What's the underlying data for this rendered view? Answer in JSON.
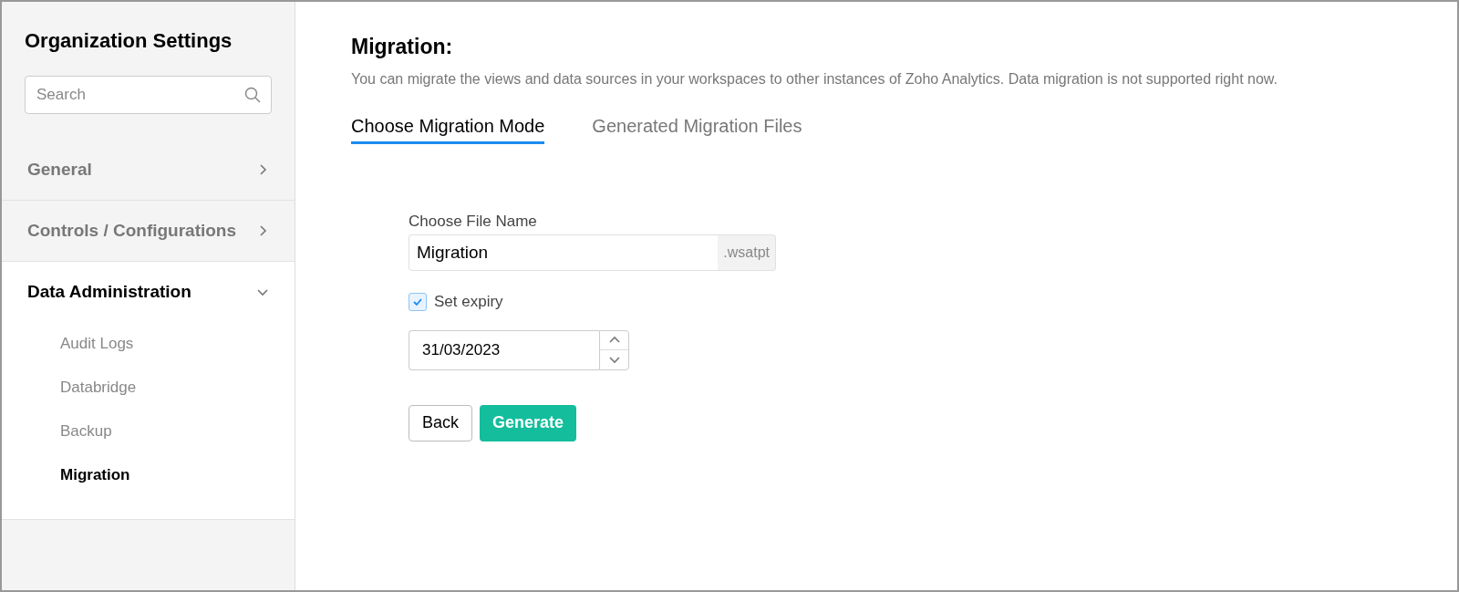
{
  "sidebar": {
    "title": "Organization Settings",
    "search": {
      "placeholder": "Search"
    },
    "sections": [
      {
        "label": "General",
        "expanded": false
      },
      {
        "label": "Controls / Configurations",
        "expanded": false
      },
      {
        "label": "Data Administration",
        "expanded": true,
        "children": [
          {
            "label": "Audit Logs",
            "selected": false
          },
          {
            "label": "Databridge",
            "selected": false
          },
          {
            "label": "Backup",
            "selected": false
          },
          {
            "label": "Migration",
            "selected": true
          }
        ]
      }
    ]
  },
  "main": {
    "title": "Migration:",
    "description": "You can migrate the views and data sources in your workspaces to other instances of Zoho Analytics. Data migration is not supported right now.",
    "tabs": [
      {
        "label": "Choose Migration Mode",
        "selected": true
      },
      {
        "label": "Generated Migration Files",
        "selected": false
      }
    ],
    "form": {
      "file_label": "Choose File Name",
      "file_value": "Migration",
      "file_suffix": ".wsatpt",
      "expiry": {
        "label": "Set expiry",
        "checked": true
      },
      "date_value": "31/03/2023",
      "buttons": [
        {
          "label": "Back",
          "kind": "secondary"
        },
        {
          "label": "Generate",
          "kind": "primary"
        }
      ]
    }
  }
}
